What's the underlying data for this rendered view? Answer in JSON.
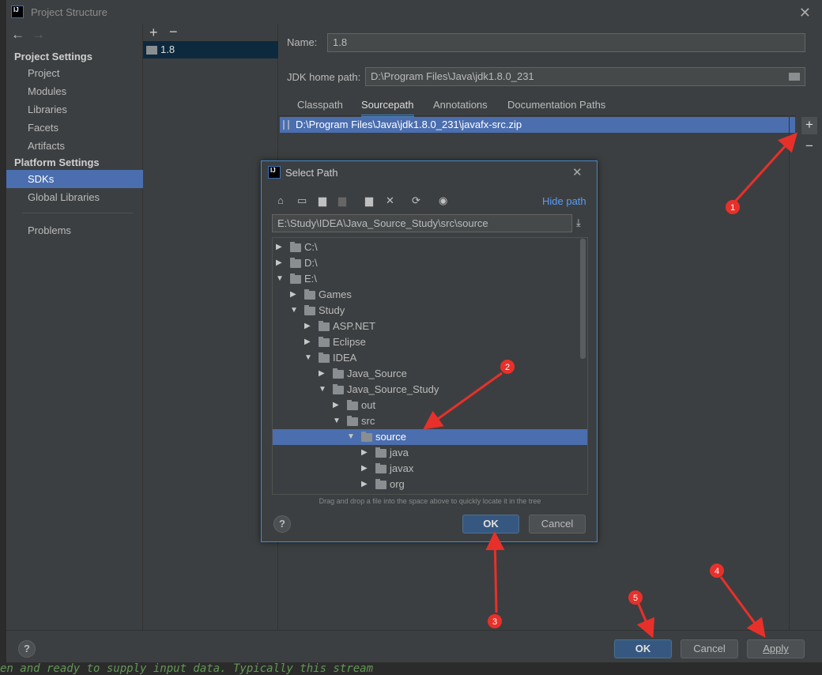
{
  "window": {
    "title": "Project Structure",
    "logo": "IJ"
  },
  "sidebar": {
    "back": "←",
    "forward": "→",
    "project_settings": "Project Settings",
    "platform_settings": "Platform Settings",
    "items": [
      {
        "label": "Project"
      },
      {
        "label": "Modules"
      },
      {
        "label": "Libraries"
      },
      {
        "label": "Facets"
      },
      {
        "label": "Artifacts"
      },
      {
        "label": "SDKs",
        "selected": true
      },
      {
        "label": "Global Libraries"
      },
      {
        "label": "Problems"
      }
    ]
  },
  "sdk_list": {
    "add": "+",
    "remove": "−",
    "items": [
      "1.8"
    ]
  },
  "sdk": {
    "name_label": "Name:",
    "name_value": "1.8",
    "home_label": "JDK home path:",
    "home_value": "D:\\Program Files\\Java\\jdk1.8.0_231",
    "tabs": [
      {
        "label": "Classpath"
      },
      {
        "label": "Sourcepath",
        "active": true
      },
      {
        "label": "Annotations"
      },
      {
        "label": "Documentation Paths"
      }
    ],
    "paths": [
      "D:\\Program Files\\Java\\jdk1.8.0_231\\javafx-src.zip"
    ],
    "add": "+",
    "remove": "−"
  },
  "footer": {
    "help": "?",
    "ok": "OK",
    "cancel": "Cancel",
    "apply": "Apply"
  },
  "dialog": {
    "title": "Select Path",
    "close": "✕",
    "hide_path": "Hide path",
    "path_value": "E:\\Study\\IDEA\\Java_Source_Study\\src\\source",
    "toolbar_icons": [
      "home-icon",
      "desktop-icon",
      "project-folder-icon",
      "module-folder-icon",
      "new-folder-icon",
      "delete-icon",
      "refresh-icon",
      "show-hidden-icon"
    ],
    "tree": [
      {
        "label": "C:\\",
        "level": 0,
        "expanded": false,
        "drive": true
      },
      {
        "label": "D:\\",
        "level": 0,
        "expanded": false,
        "drive": true
      },
      {
        "label": "E:\\",
        "level": 0,
        "expanded": true,
        "drive": true
      },
      {
        "label": "Games",
        "level": 1,
        "expanded": false
      },
      {
        "label": "Study",
        "level": 1,
        "expanded": true
      },
      {
        "label": "ASP.NET",
        "level": 2,
        "expanded": false
      },
      {
        "label": "Eclipse",
        "level": 2,
        "expanded": false
      },
      {
        "label": "IDEA",
        "level": 2,
        "expanded": true
      },
      {
        "label": "Java_Source",
        "level": 3,
        "expanded": false
      },
      {
        "label": "Java_Source_Study",
        "level": 3,
        "expanded": true
      },
      {
        "label": "out",
        "level": 4,
        "expanded": false
      },
      {
        "label": "src",
        "level": 4,
        "expanded": true
      },
      {
        "label": "source",
        "level": 5,
        "expanded": true,
        "selected": true
      },
      {
        "label": "java",
        "level": 6,
        "expanded": false
      },
      {
        "label": "javax",
        "level": 6,
        "expanded": false
      },
      {
        "label": "org",
        "level": 6,
        "expanded": false
      }
    ],
    "hint": "Drag and drop a file into the space above to quickly locate it in the tree",
    "help": "?",
    "ok": "OK",
    "cancel": "Cancel"
  },
  "annotations": {
    "color": "#e8302a",
    "steps": [
      "1",
      "2",
      "3",
      "4",
      "5"
    ]
  },
  "editor": {
    "bottom_line": "en and ready to supply input data. Typically this stream"
  },
  "colors": {
    "accent": "#4b6eaf",
    "panel": "#3c3f41",
    "default_button": "#365880",
    "link": "#589df6"
  }
}
